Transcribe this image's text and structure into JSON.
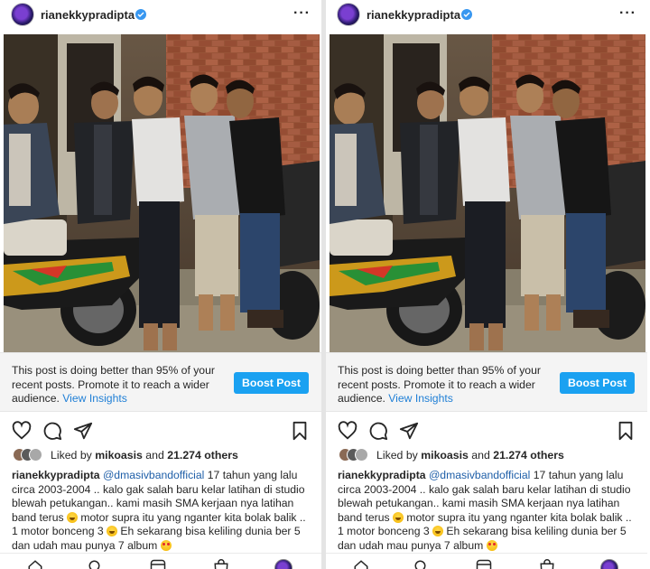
{
  "post": {
    "username": "rianekkypradipta",
    "verified_icon": "verified-badge-icon",
    "more_icon": "more-options-icon",
    "more_label": "···",
    "insights": {
      "text": "This post is doing better than 95% of your recent posts. Promote it to reach a wider audience.",
      "link": "View Insights",
      "button": "Boost Post"
    },
    "actions": [
      "heart-icon",
      "comment-icon",
      "share-icon",
      "bookmark-icon"
    ],
    "likes": {
      "prefix": "Liked by",
      "user": "mikoasis",
      "conj": "and",
      "count": "21.274 others"
    },
    "caption": {
      "username": "rianekkypradipta",
      "mention": "@dmasivbandofficial",
      "part1": " 17 tahun yang lalu circa 2003-2004 .. kalo gak salah baru kelar latihan di studio blewah petukangan.. kami masih SMA kerjaan nya latihan band terus ",
      "part2": " motor supra itu yang nganter kita bolak balik .. 1 motor bonceng 3 ",
      "part3": " Eh sekarang bisa keliling dunia ber 5 dan udah mau punya 7 album "
    },
    "nav": [
      "home-icon",
      "search-icon",
      "reels-icon",
      "shop-icon",
      "profile-avatar"
    ]
  },
  "colors": {
    "boost": "#1aa1f1",
    "link": "#1f7fd6",
    "verified": "#3897f0"
  }
}
